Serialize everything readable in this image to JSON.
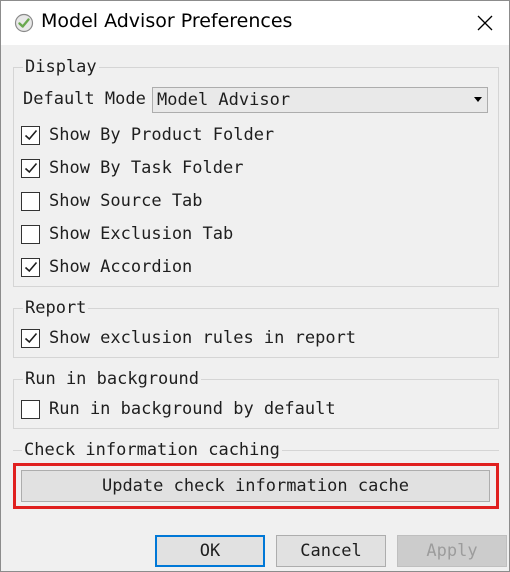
{
  "window": {
    "title": "Model Advisor Preferences"
  },
  "display": {
    "legend": "Display",
    "default_mode_label": "Default Mode",
    "default_mode_value": "Model Advisor",
    "options": [
      {
        "label": "Show By Product Folder",
        "checked": true
      },
      {
        "label": "Show By Task Folder",
        "checked": true
      },
      {
        "label": "Show Source Tab",
        "checked": false
      },
      {
        "label": "Show Exclusion Tab",
        "checked": false
      },
      {
        "label": "Show Accordion",
        "checked": true
      }
    ]
  },
  "report": {
    "legend": "Report",
    "option": {
      "label": "Show exclusion rules in report",
      "checked": true
    }
  },
  "background": {
    "legend": "Run in background",
    "option": {
      "label": "Run in background by default",
      "checked": false
    }
  },
  "caching": {
    "legend": "Check information caching",
    "update_button": "Update check information cache"
  },
  "buttons": {
    "ok": "OK",
    "cancel": "Cancel",
    "apply": "Apply"
  },
  "colors": {
    "highlight": "#e0201f",
    "focus": "#0078d7",
    "app_icon": "#6aa84f"
  },
  "icons": {
    "app": "check-circle-icon",
    "close": "close-icon",
    "checkbox": "checkmark-icon"
  }
}
